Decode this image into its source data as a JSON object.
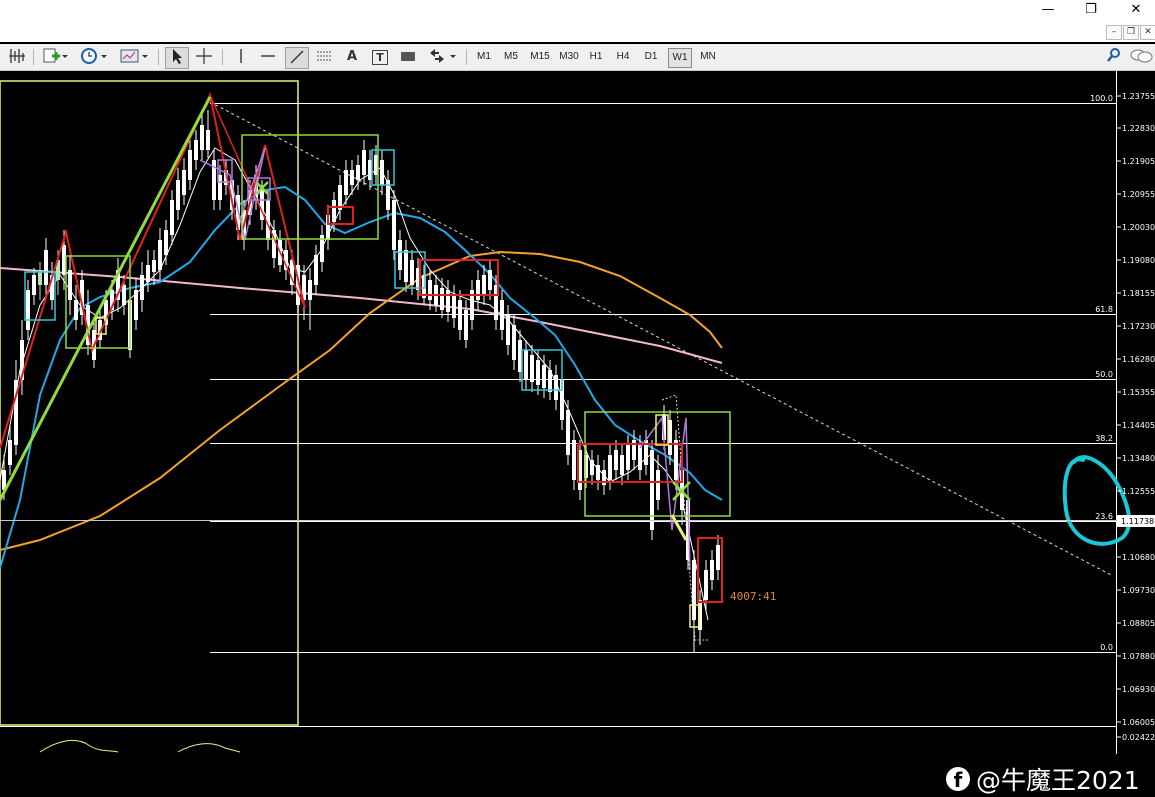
{
  "window": {
    "minimize_glyph": "—",
    "restore_glyph": "❐",
    "close_glyph": "✕",
    "mdi_minimize_glyph": "–",
    "mdi_restore_glyph": "❐",
    "mdi_close_glyph": "✕"
  },
  "toolbar": {
    "timeframes": [
      "M1",
      "M5",
      "M15",
      "M30",
      "H1",
      "H4",
      "D1",
      "W1",
      "MN"
    ],
    "active_timeframe": "W1",
    "tools": [
      "crosshair-lines-icon",
      "new-order-icon",
      "clock-icon",
      "chart-template-icon",
      "cursor-icon",
      "crosshair-icon",
      "vertical-line-icon",
      "horizontal-line-icon",
      "trendline-icon",
      "equidistant-channel-icon",
      "text-icon",
      "text-label-icon",
      "rectangle-icon",
      "arrows-icon",
      "search-icon",
      "chat-icon"
    ],
    "text_tool_glyph": "A",
    "label_tool_glyph": "T"
  },
  "price_axis": {
    "labels": [
      "1.23755",
      "1.22830",
      "1.21905",
      "1.20955",
      "1.20030",
      "1.19080",
      "1.18155",
      "1.17230",
      "1.16280",
      "1.15355",
      "1.14405",
      "1.13480",
      "1.12555",
      "1.11738",
      "1.10680",
      "1.09730",
      "1.08805",
      "1.07880",
      "1.06930",
      "1.06005",
      "0.02422"
    ],
    "current_price": "1.11738"
  },
  "fibonacci_levels": [
    {
      "label": "100.0"
    },
    {
      "label": "61.8"
    },
    {
      "label": "50.0"
    },
    {
      "label": "38.2"
    },
    {
      "label": "23.6"
    },
    {
      "label": "0.0"
    }
  ],
  "order_label": "4007:41",
  "watermark": {
    "icon_glyph": "f",
    "text": "@牛魔王2021"
  },
  "colors": {
    "background": "#000000",
    "bull_candle": "#b7e4b0",
    "bear_candle": "#ffffff",
    "ma_fast": "#ffffff",
    "ma_mid": "#1fa9ea",
    "ma_slow": "#f5a12d",
    "ma_long": "#f2b8d0",
    "fib_line": "#ffffff",
    "box_green": "#8fdc3c",
    "box_red": "#e02020",
    "box_cyan": "#32c8dc",
    "box_yellow": "#f0f07a",
    "annotation_cyan": "#18c8d8"
  }
}
